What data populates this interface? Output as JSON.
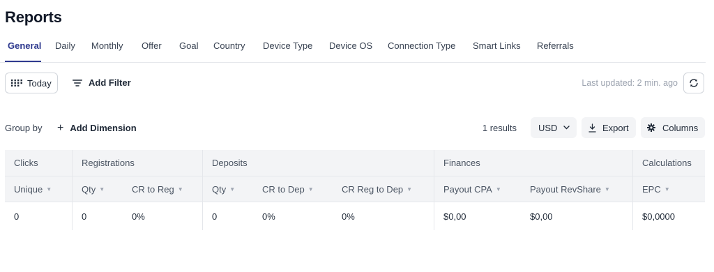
{
  "page": {
    "title": "Reports"
  },
  "tabs": [
    {
      "label": "General",
      "active": true
    },
    {
      "label": "Daily",
      "active": false
    },
    {
      "label": "Monthly",
      "active": false
    },
    {
      "label": "Offer",
      "active": false
    },
    {
      "label": "Goal",
      "active": false
    },
    {
      "label": "Country",
      "active": false
    },
    {
      "label": "Device Type",
      "active": false
    },
    {
      "label": "Device OS",
      "active": false
    },
    {
      "label": "Connection Type",
      "active": false
    },
    {
      "label": "Smart Links",
      "active": false
    },
    {
      "label": "Referrals",
      "active": false
    }
  ],
  "filters": {
    "date_label": "Today",
    "date_icon": "calendar-grid-icon",
    "add_filter_label": "Add Filter",
    "filter_icon": "filter-lines-icon",
    "last_updated": "Last updated: 2 min. ago",
    "refresh_icon": "refresh-icon"
  },
  "toolbar": {
    "group_by_label": "Group by",
    "add_dimension_label": "Add Dimension",
    "results_text": "1 results",
    "currency": "USD",
    "export_label": "Export",
    "columns_label": "Columns"
  },
  "table": {
    "groups": [
      "Clicks",
      "Registrations",
      "Deposits",
      "Finances",
      "Calculations"
    ],
    "columns": [
      "Unique",
      "Qty",
      "CR to Reg",
      "Qty",
      "CR to Dep",
      "CR Reg to Dep",
      "Payout CPA",
      "Payout RevShare",
      "EPC"
    ],
    "sortable": [
      true,
      true,
      true,
      true,
      true,
      true,
      true,
      true,
      true
    ],
    "rows": [
      [
        "0",
        "0",
        "0%",
        "0",
        "0%",
        "0%",
        "$0,00",
        "$0,00",
        "$0,0000"
      ]
    ]
  },
  "colors": {
    "accent": "#2f3a8f",
    "header_bg": "#f3f4f6",
    "border": "#e5e7eb",
    "muted_text": "#9ca3af"
  }
}
